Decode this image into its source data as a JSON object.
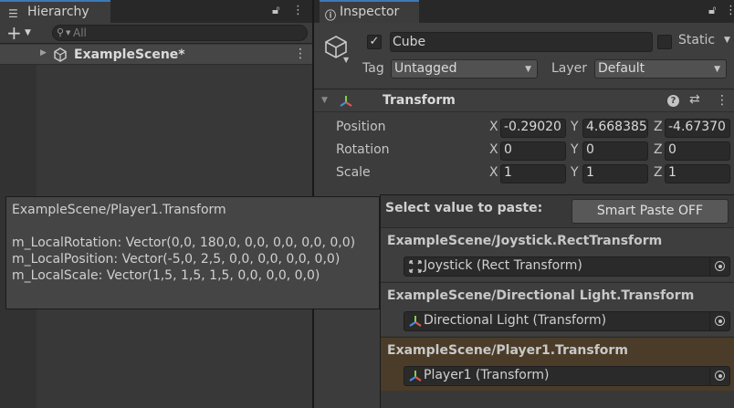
{
  "hierarchy": {
    "tab_label": "Hierarchy",
    "search_placeholder": "All",
    "scene_label": "ExampleScene*"
  },
  "inspector": {
    "tab_label": "Inspector",
    "object_name": "Cube",
    "active": true,
    "static_label": "Static",
    "tag_label": "Tag",
    "tag_value": "Untagged",
    "layer_label": "Layer",
    "layer_value": "Default"
  },
  "transform": {
    "title": "Transform",
    "position": {
      "label": "Position",
      "x": "-0.29020",
      "y": "4.668385",
      "z": "-4.67370"
    },
    "rotation": {
      "label": "Rotation",
      "x": "0",
      "y": "0",
      "z": "0"
    },
    "scale": {
      "label": "Scale",
      "x": "1",
      "y": "1",
      "z": "1"
    },
    "axis": {
      "x": "X",
      "y": "Y",
      "z": "Z"
    }
  },
  "tooltip": {
    "title": "ExampleScene/Player1.Transform",
    "lines": [
      "m_LocalRotation: Vector(0,0, 180,0, 0,0, 0,0, 0,0, 0,0)",
      "m_LocalPosition: Vector(-5,0, 2,5, 0,0, 0,0, 0,0, 0,0)",
      "m_LocalScale: Vector(1,5, 1,5, 1,5, 0,0, 0,0, 0,0)"
    ]
  },
  "paste": {
    "title": "Select value to paste:",
    "smart_paste_label": "Smart Paste OFF",
    "items": [
      {
        "path": "ExampleScene/Joystick.RectTransform",
        "object": "Joystick (Rect Transform)",
        "icon": "rect-transform-icon"
      },
      {
        "path": "ExampleScene/Directional Light.Transform",
        "object": "Directional Light (Transform)",
        "icon": "transform-icon"
      },
      {
        "path": "ExampleScene/Player1.Transform",
        "object": "Player1 (Transform)",
        "icon": "transform-icon",
        "selected": true
      }
    ]
  },
  "colors": {
    "selection_highlight": "#4a3c28",
    "tab_accent": "#3a79bb",
    "panel_bg": "#383838"
  }
}
